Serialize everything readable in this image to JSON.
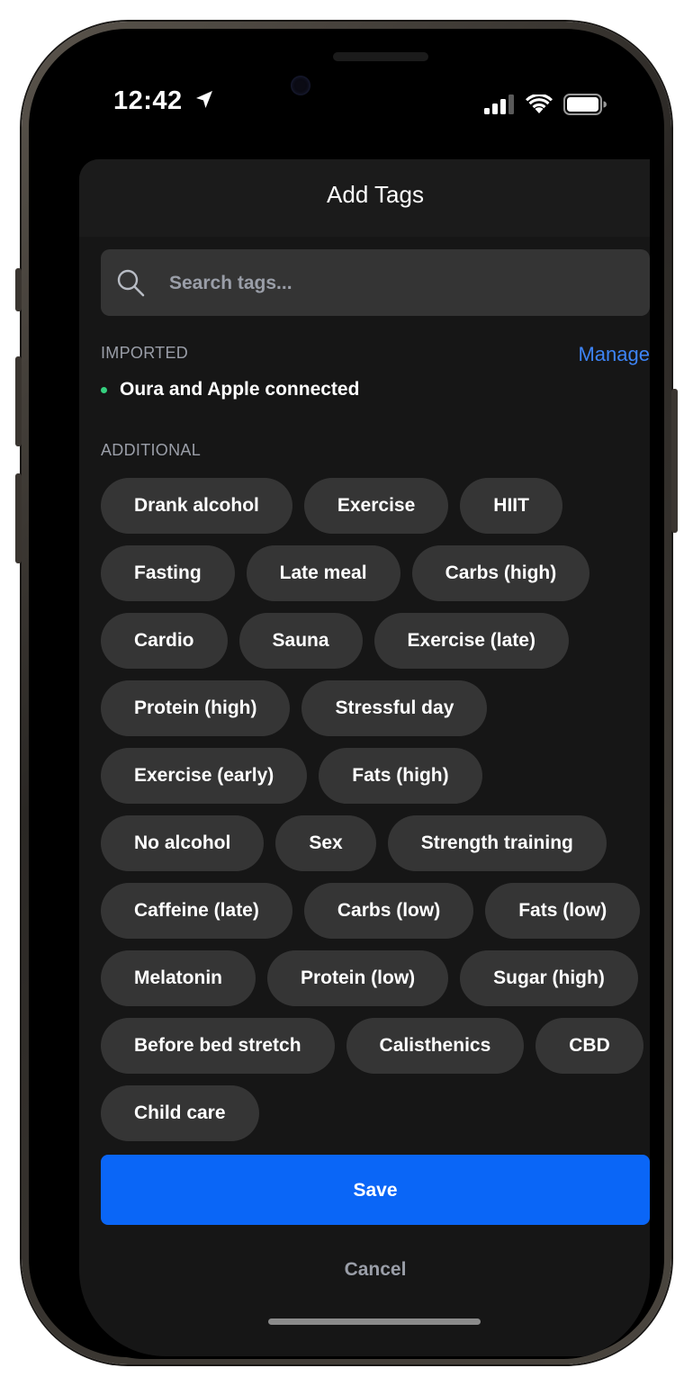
{
  "status_bar": {
    "time": "12:42",
    "icons": [
      "location-arrow-icon",
      "cellular-signal-icon",
      "wifi-icon",
      "battery-icon"
    ]
  },
  "sheet": {
    "title": "Add Tags"
  },
  "search": {
    "placeholder": "Search tags...",
    "value": "",
    "icon": "search-icon"
  },
  "imported": {
    "label": "IMPORTED",
    "manage_label": "Manage",
    "status_text": "Oura and Apple connected"
  },
  "additional": {
    "label": "ADDITIONAL",
    "tags": [
      "Drank alcohol",
      "Exercise",
      "HIIT",
      "Fasting",
      "Late meal",
      "Carbs (high)",
      "Cardio",
      "Sauna",
      "Exercise (late)",
      "Protein (high)",
      "Stressful day",
      "Exercise (early)",
      "Fats (high)",
      "No alcohol",
      "Sex",
      "Strength training",
      "Caffeine (late)",
      "Carbs (low)",
      "Fats (low)",
      "Melatonin",
      "Protein (low)",
      "Sugar (high)",
      "Before bed stretch",
      "Calisthenics",
      "CBD",
      "Child care"
    ]
  },
  "actions": {
    "save_label": "Save",
    "cancel_label": "Cancel"
  },
  "colors": {
    "accent": "#0a66f7",
    "link": "#3d84f6",
    "chip_bg": "#353535",
    "sheet_bg": "#161616",
    "connected_dot": "#35d07f"
  }
}
